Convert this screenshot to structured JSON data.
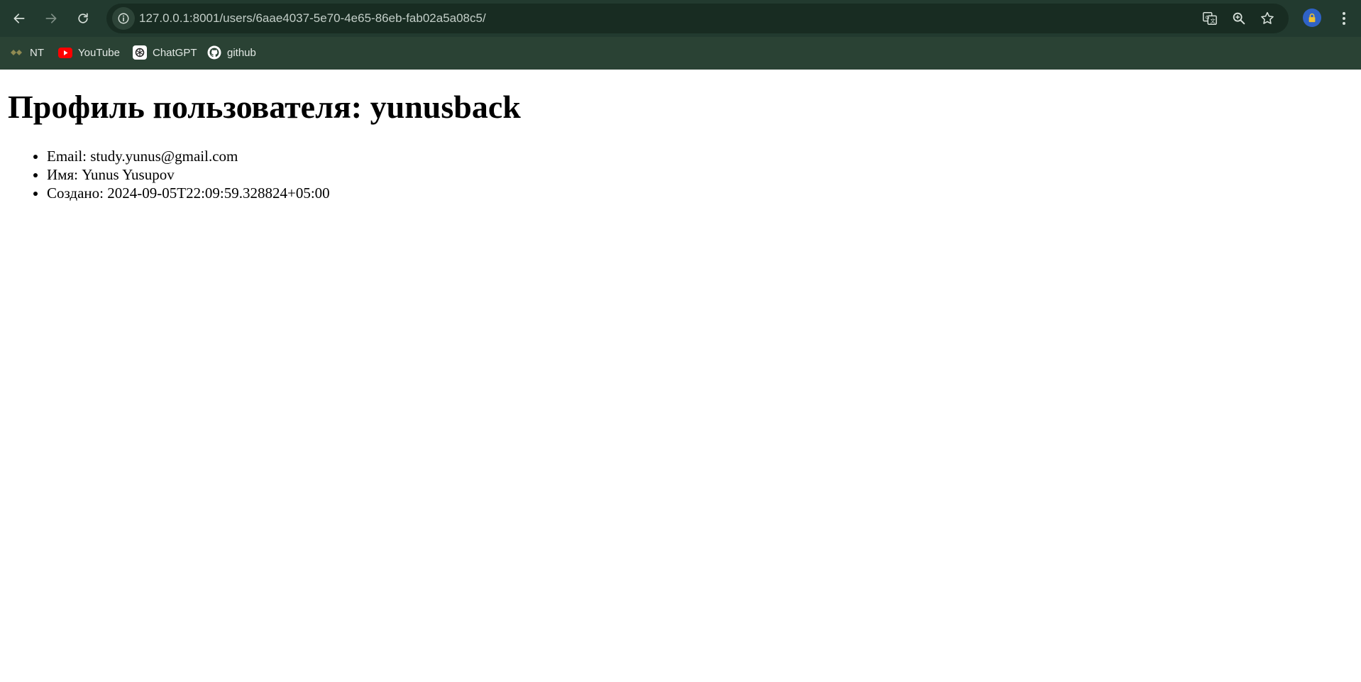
{
  "browser": {
    "url": "127.0.0.1:8001/users/6aae4037-5e70-4e65-86eb-fab02a5a08c5/",
    "bookmarks": [
      {
        "label": "NT",
        "icon": "nt-logo-icon"
      },
      {
        "label": "YouTube",
        "icon": "youtube-icon"
      },
      {
        "label": "ChatGPT",
        "icon": "chatgpt-icon"
      },
      {
        "label": "github",
        "icon": "github-icon"
      }
    ],
    "colors": {
      "toolbar": "#223a2f",
      "bookmarks_bar": "#2a4234",
      "omnibox": "#182c22"
    }
  },
  "page": {
    "title": "Профиль пользователя: yunusback",
    "details": [
      "Email: study.yunus@gmail.com",
      "Имя: Yunus Yusupov",
      "Создано: 2024-09-05T22:09:59.328824+05:00"
    ]
  }
}
